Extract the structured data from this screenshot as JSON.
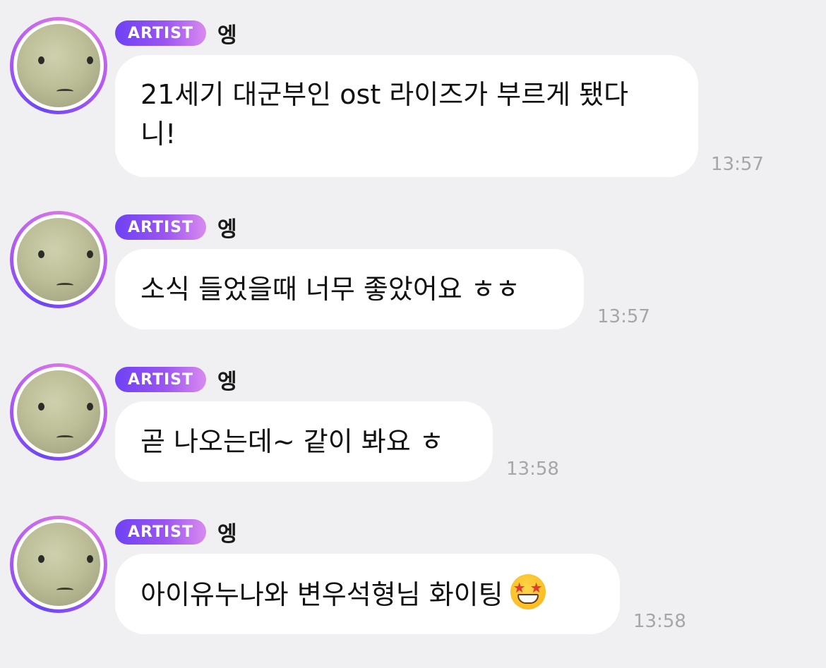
{
  "messages": [
    {
      "badge": "ARTIST",
      "name": "엥",
      "text_line1": "21세기 대군부인 ost 라이즈가 부르게 됐다",
      "text_line2": "니!",
      "time": "13:57"
    },
    {
      "badge": "ARTIST",
      "name": "엥",
      "text": "소식 들었을때 너무 좋았어요 ㅎㅎ",
      "time": "13:57"
    },
    {
      "badge": "ARTIST",
      "name": "엥",
      "text": "곧 나오는데~ 같이 봐요 ㅎ",
      "time": "13:58"
    },
    {
      "badge": "ARTIST",
      "name": "엥",
      "text": "아이유누나와 변우석형님 화이팅",
      "emoji": "star-struck-emoji",
      "time": "13:58"
    }
  ],
  "colors": {
    "background": "#f0f0f2",
    "bubble": "#ffffff",
    "badge_start": "#6d42f4",
    "badge_end": "#d98af0",
    "timestamp": "#a6a6aa"
  }
}
